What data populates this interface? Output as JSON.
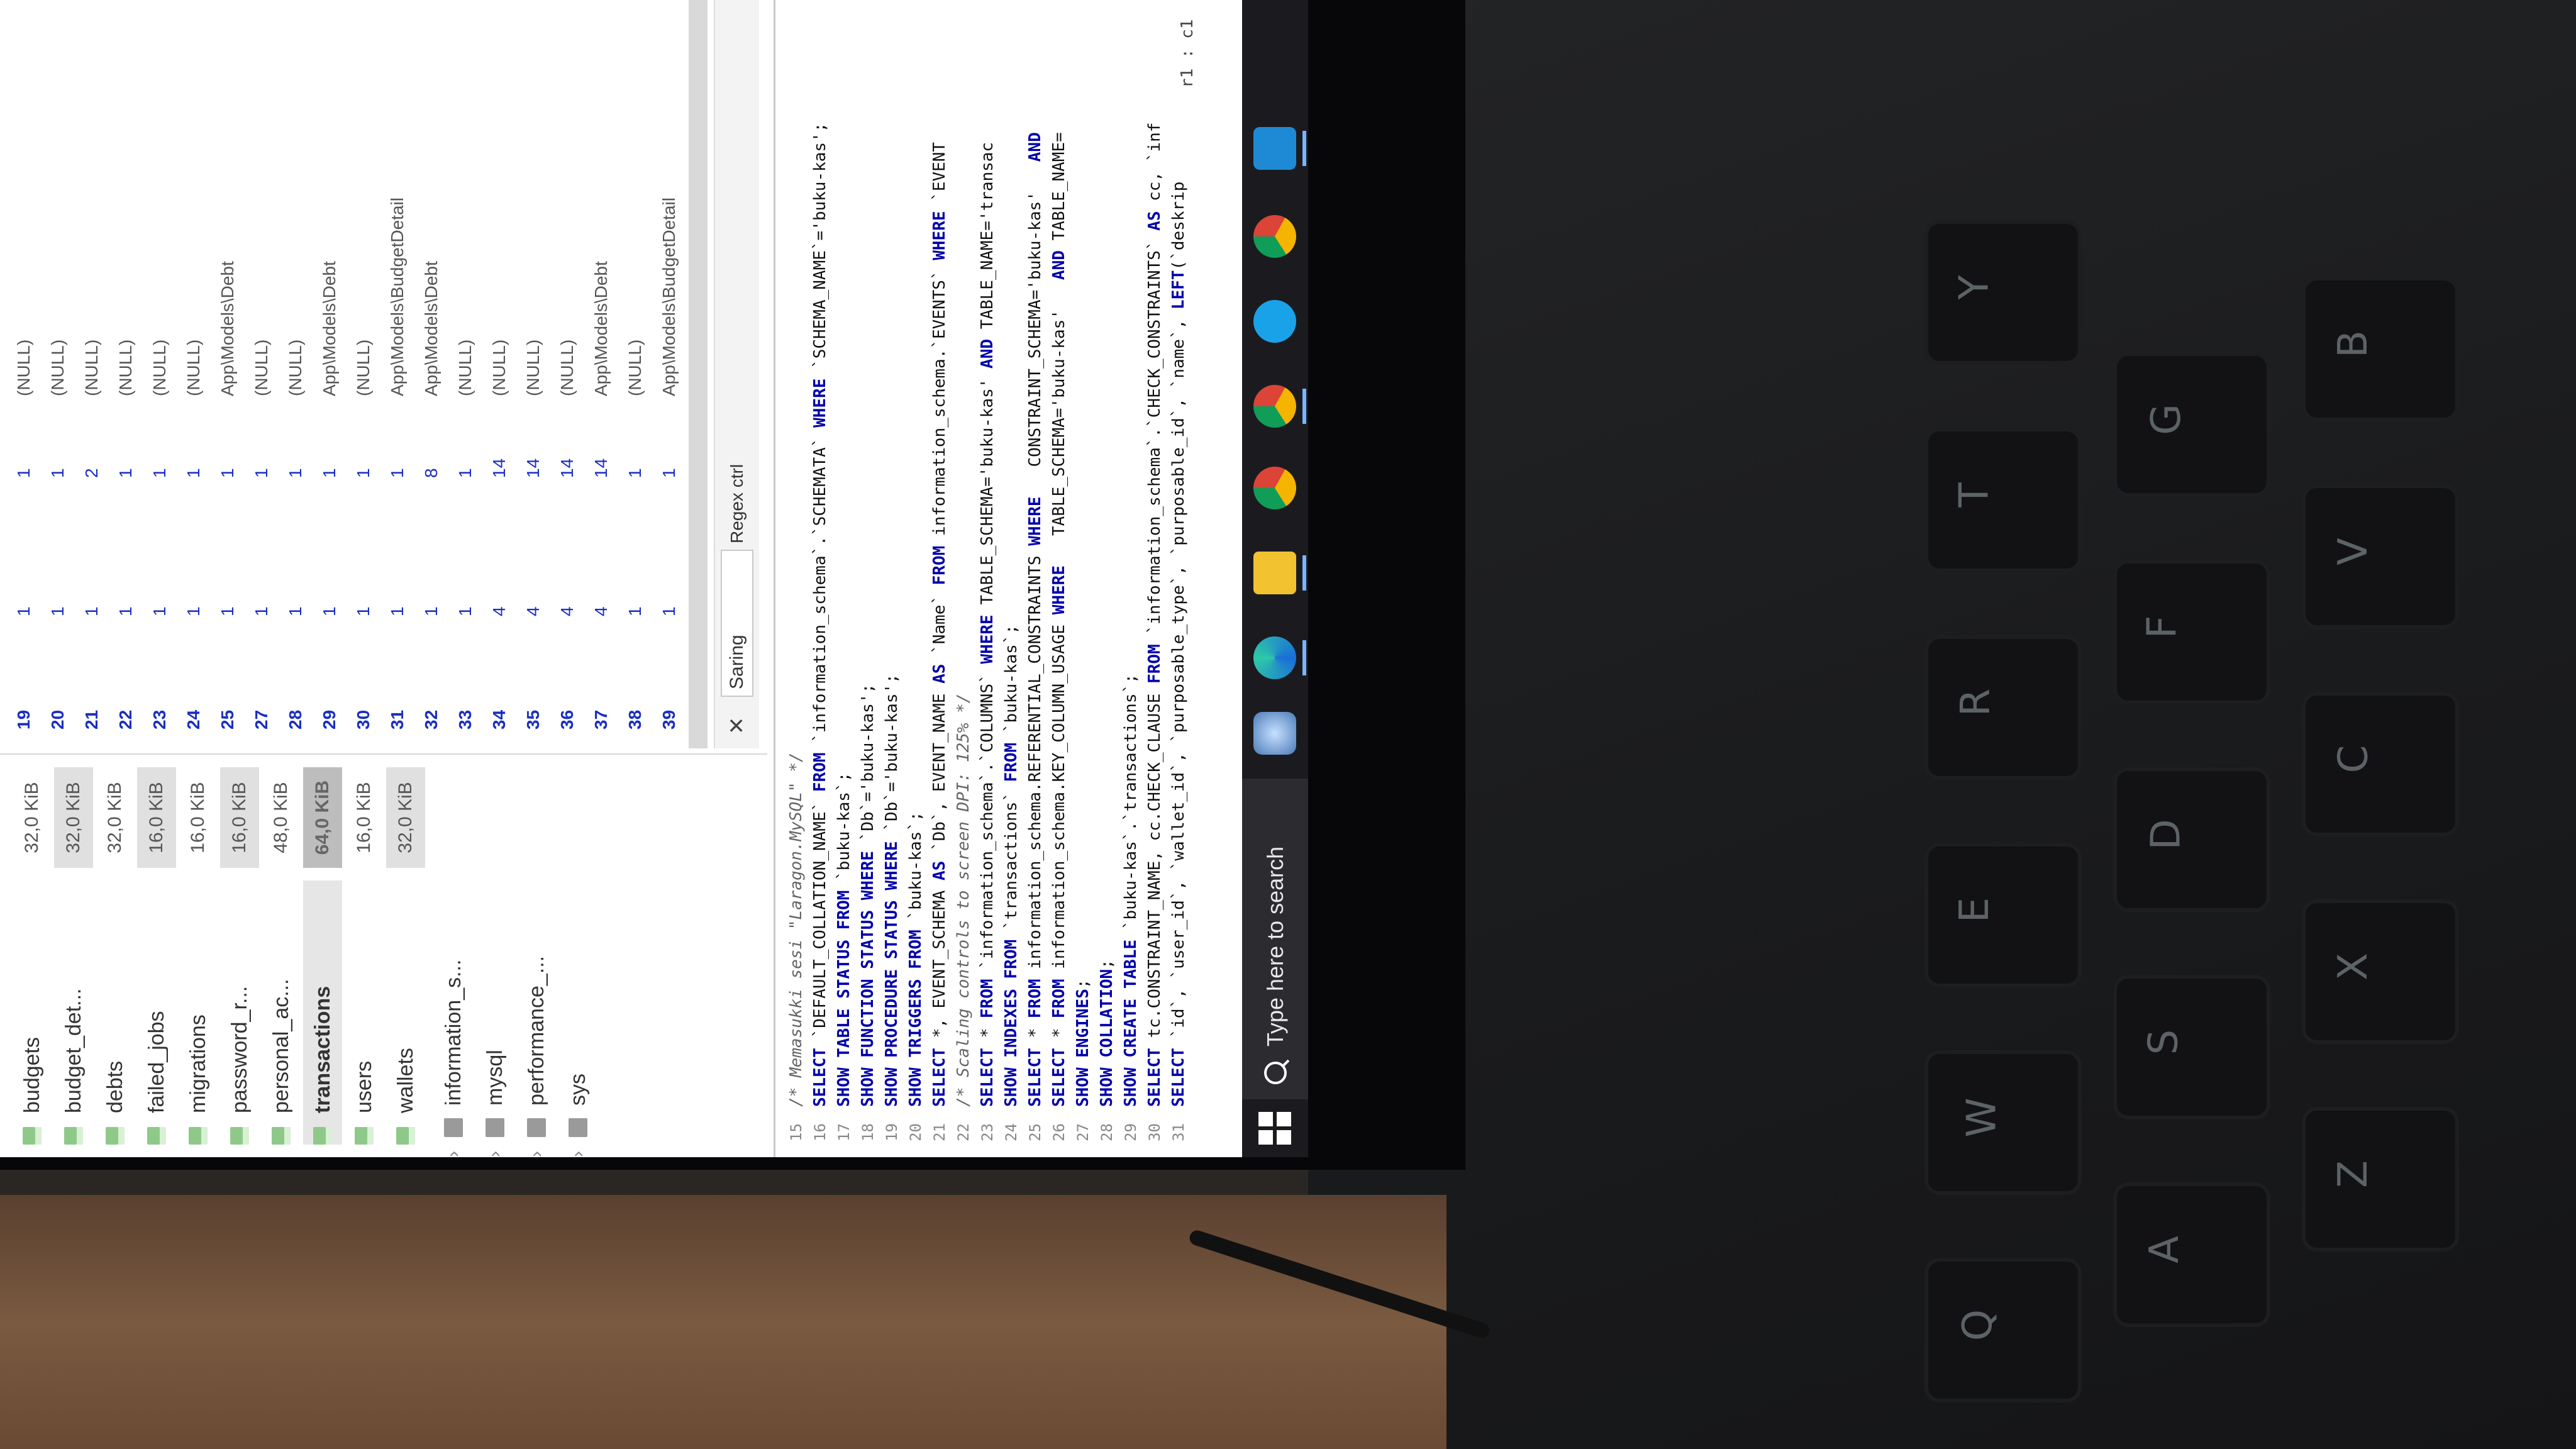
{
  "tree": {
    "tables": [
      {
        "name": "budgets",
        "size": "32,0 KiB"
      },
      {
        "name": "budget_det...",
        "size": "32,0 KiB"
      },
      {
        "name": "debts",
        "size": "32,0 KiB"
      },
      {
        "name": "failed_jobs",
        "size": "16,0 KiB"
      },
      {
        "name": "migrations",
        "size": "16,0 KiB"
      },
      {
        "name": "password_r...",
        "size": "16,0 KiB"
      },
      {
        "name": "personal_ac...",
        "size": "48,0 KiB"
      },
      {
        "name": "transactions",
        "size": "64,0 KiB"
      },
      {
        "name": "users",
        "size": "16,0 KiB"
      },
      {
        "name": "wallets",
        "size": "32,0 KiB"
      }
    ],
    "databases": [
      "information_s...",
      "mysql",
      "performance_...",
      "sys"
    ]
  },
  "grid": {
    "rows": [
      {
        "id": "19",
        "a": "1",
        "b": "1",
        "c": "(NULL)"
      },
      {
        "id": "20",
        "a": "1",
        "b": "1",
        "c": "(NULL)"
      },
      {
        "id": "21",
        "a": "1",
        "b": "2",
        "c": "(NULL)"
      },
      {
        "id": "22",
        "a": "1",
        "b": "1",
        "c": "(NULL)"
      },
      {
        "id": "23",
        "a": "1",
        "b": "1",
        "c": "(NULL)"
      },
      {
        "id": "24",
        "a": "1",
        "b": "1",
        "c": "(NULL)"
      },
      {
        "id": "25",
        "a": "1",
        "b": "1",
        "c": "App\\Models\\Debt"
      },
      {
        "id": "27",
        "a": "1",
        "b": "1",
        "c": "(NULL)"
      },
      {
        "id": "28",
        "a": "1",
        "b": "1",
        "c": "(NULL)"
      },
      {
        "id": "29",
        "a": "1",
        "b": "1",
        "c": "App\\Models\\Debt"
      },
      {
        "id": "30",
        "a": "1",
        "b": "1",
        "c": "(NULL)"
      },
      {
        "id": "31",
        "a": "1",
        "b": "1",
        "c": "App\\Models\\BudgetDetail"
      },
      {
        "id": "32",
        "a": "1",
        "b": "8",
        "c": "App\\Models\\Debt"
      },
      {
        "id": "33",
        "a": "1",
        "b": "1",
        "c": "(NULL)"
      },
      {
        "id": "34",
        "a": "4",
        "b": "14",
        "c": "(NULL)"
      },
      {
        "id": "35",
        "a": "4",
        "b": "14",
        "c": "(NULL)"
      },
      {
        "id": "36",
        "a": "4",
        "b": "14",
        "c": "(NULL)"
      },
      {
        "id": "37",
        "a": "4",
        "b": "14",
        "c": "App\\Models\\Debt"
      },
      {
        "id": "38",
        "a": "1",
        "b": "1",
        "c": "(NULL)"
      },
      {
        "id": "39",
        "a": "1",
        "b": "1",
        "c": "App\\Models\\BudgetDetail"
      }
    ]
  },
  "search": {
    "close": "✕",
    "placeholder": "Saring",
    "option": "Regex ctrl"
  },
  "editor": {
    "lines": [
      {
        "n": "15",
        "text": "/* Memasukki sesi \"Laragon.MySQL\" */"
      },
      {
        "n": "16",
        "text": "SELECT `DEFAULT_COLLATION_NAME` FROM `information_schema`.`SCHEMATA` WHERE `SCHEMA_NAME`='buku-kas';"
      },
      {
        "n": "17",
        "text": "SHOW TABLE STATUS FROM `buku-kas`;"
      },
      {
        "n": "18",
        "text": "SHOW FUNCTION STATUS WHERE `Db`='buku-kas';"
      },
      {
        "n": "19",
        "text": "SHOW PROCEDURE STATUS WHERE `Db`='buku-kas';"
      },
      {
        "n": "20",
        "text": "SHOW TRIGGERS FROM `buku-kas`;"
      },
      {
        "n": "21",
        "text": "SELECT *, EVENT_SCHEMA AS `Db`, EVENT_NAME AS `Name` FROM information_schema.`EVENTS` WHERE `EVENT"
      },
      {
        "n": "22",
        "text": "/* Scaling controls to screen DPI: 125% */"
      },
      {
        "n": "23",
        "text": "SELECT * FROM `information_schema`.`COLUMNS` WHERE TABLE_SCHEMA='buku-kas' AND TABLE_NAME='transac"
      },
      {
        "n": "24",
        "text": "SHOW INDEXES FROM `transactions` FROM `buku-kas`;"
      },
      {
        "n": "25",
        "text": "SELECT * FROM information_schema.REFERENTIAL_CONSTRAINTS WHERE   CONSTRAINT_SCHEMA='buku-kas'   AND"
      },
      {
        "n": "26",
        "text": "SELECT * FROM information_schema.KEY_COLUMN_USAGE WHERE   TABLE_SCHEMA='buku-kas'   AND TABLE_NAME="
      },
      {
        "n": "27",
        "text": "SHOW ENGINES;"
      },
      {
        "n": "28",
        "text": "SHOW COLLATION;"
      },
      {
        "n": "29",
        "text": "SHOW CREATE TABLE `buku-kas`.`transactions`;"
      },
      {
        "n": "30",
        "text": "SELECT tc.CONSTRAINT_NAME, cc.CHECK_CLAUSE FROM `information_schema`.`CHECK_CONSTRAINTS` AS cc, `inf"
      },
      {
        "n": "31",
        "text": "SELECT `id`, `user_id`, `wallet_id`, `purposable_type`, `purposable_id`, `name`, LEFT(`deskrip"
      }
    ],
    "cursor": "r1 : c1"
  },
  "taskbar": {
    "search_placeholder": "Type here to search"
  },
  "colors": {
    "keyword": "#0000aa",
    "row_number": "#1a2fc0",
    "table_icon": "#8fc98a",
    "taskbar": "#1b1b1f"
  },
  "icons": [
    "windows-start-icon",
    "search-icon",
    "edge-icon",
    "file-explorer-icon",
    "chrome-icon",
    "chrome-profile-icon",
    "app-icon",
    "chrome-profile-2-icon",
    "vscode-icon"
  ]
}
